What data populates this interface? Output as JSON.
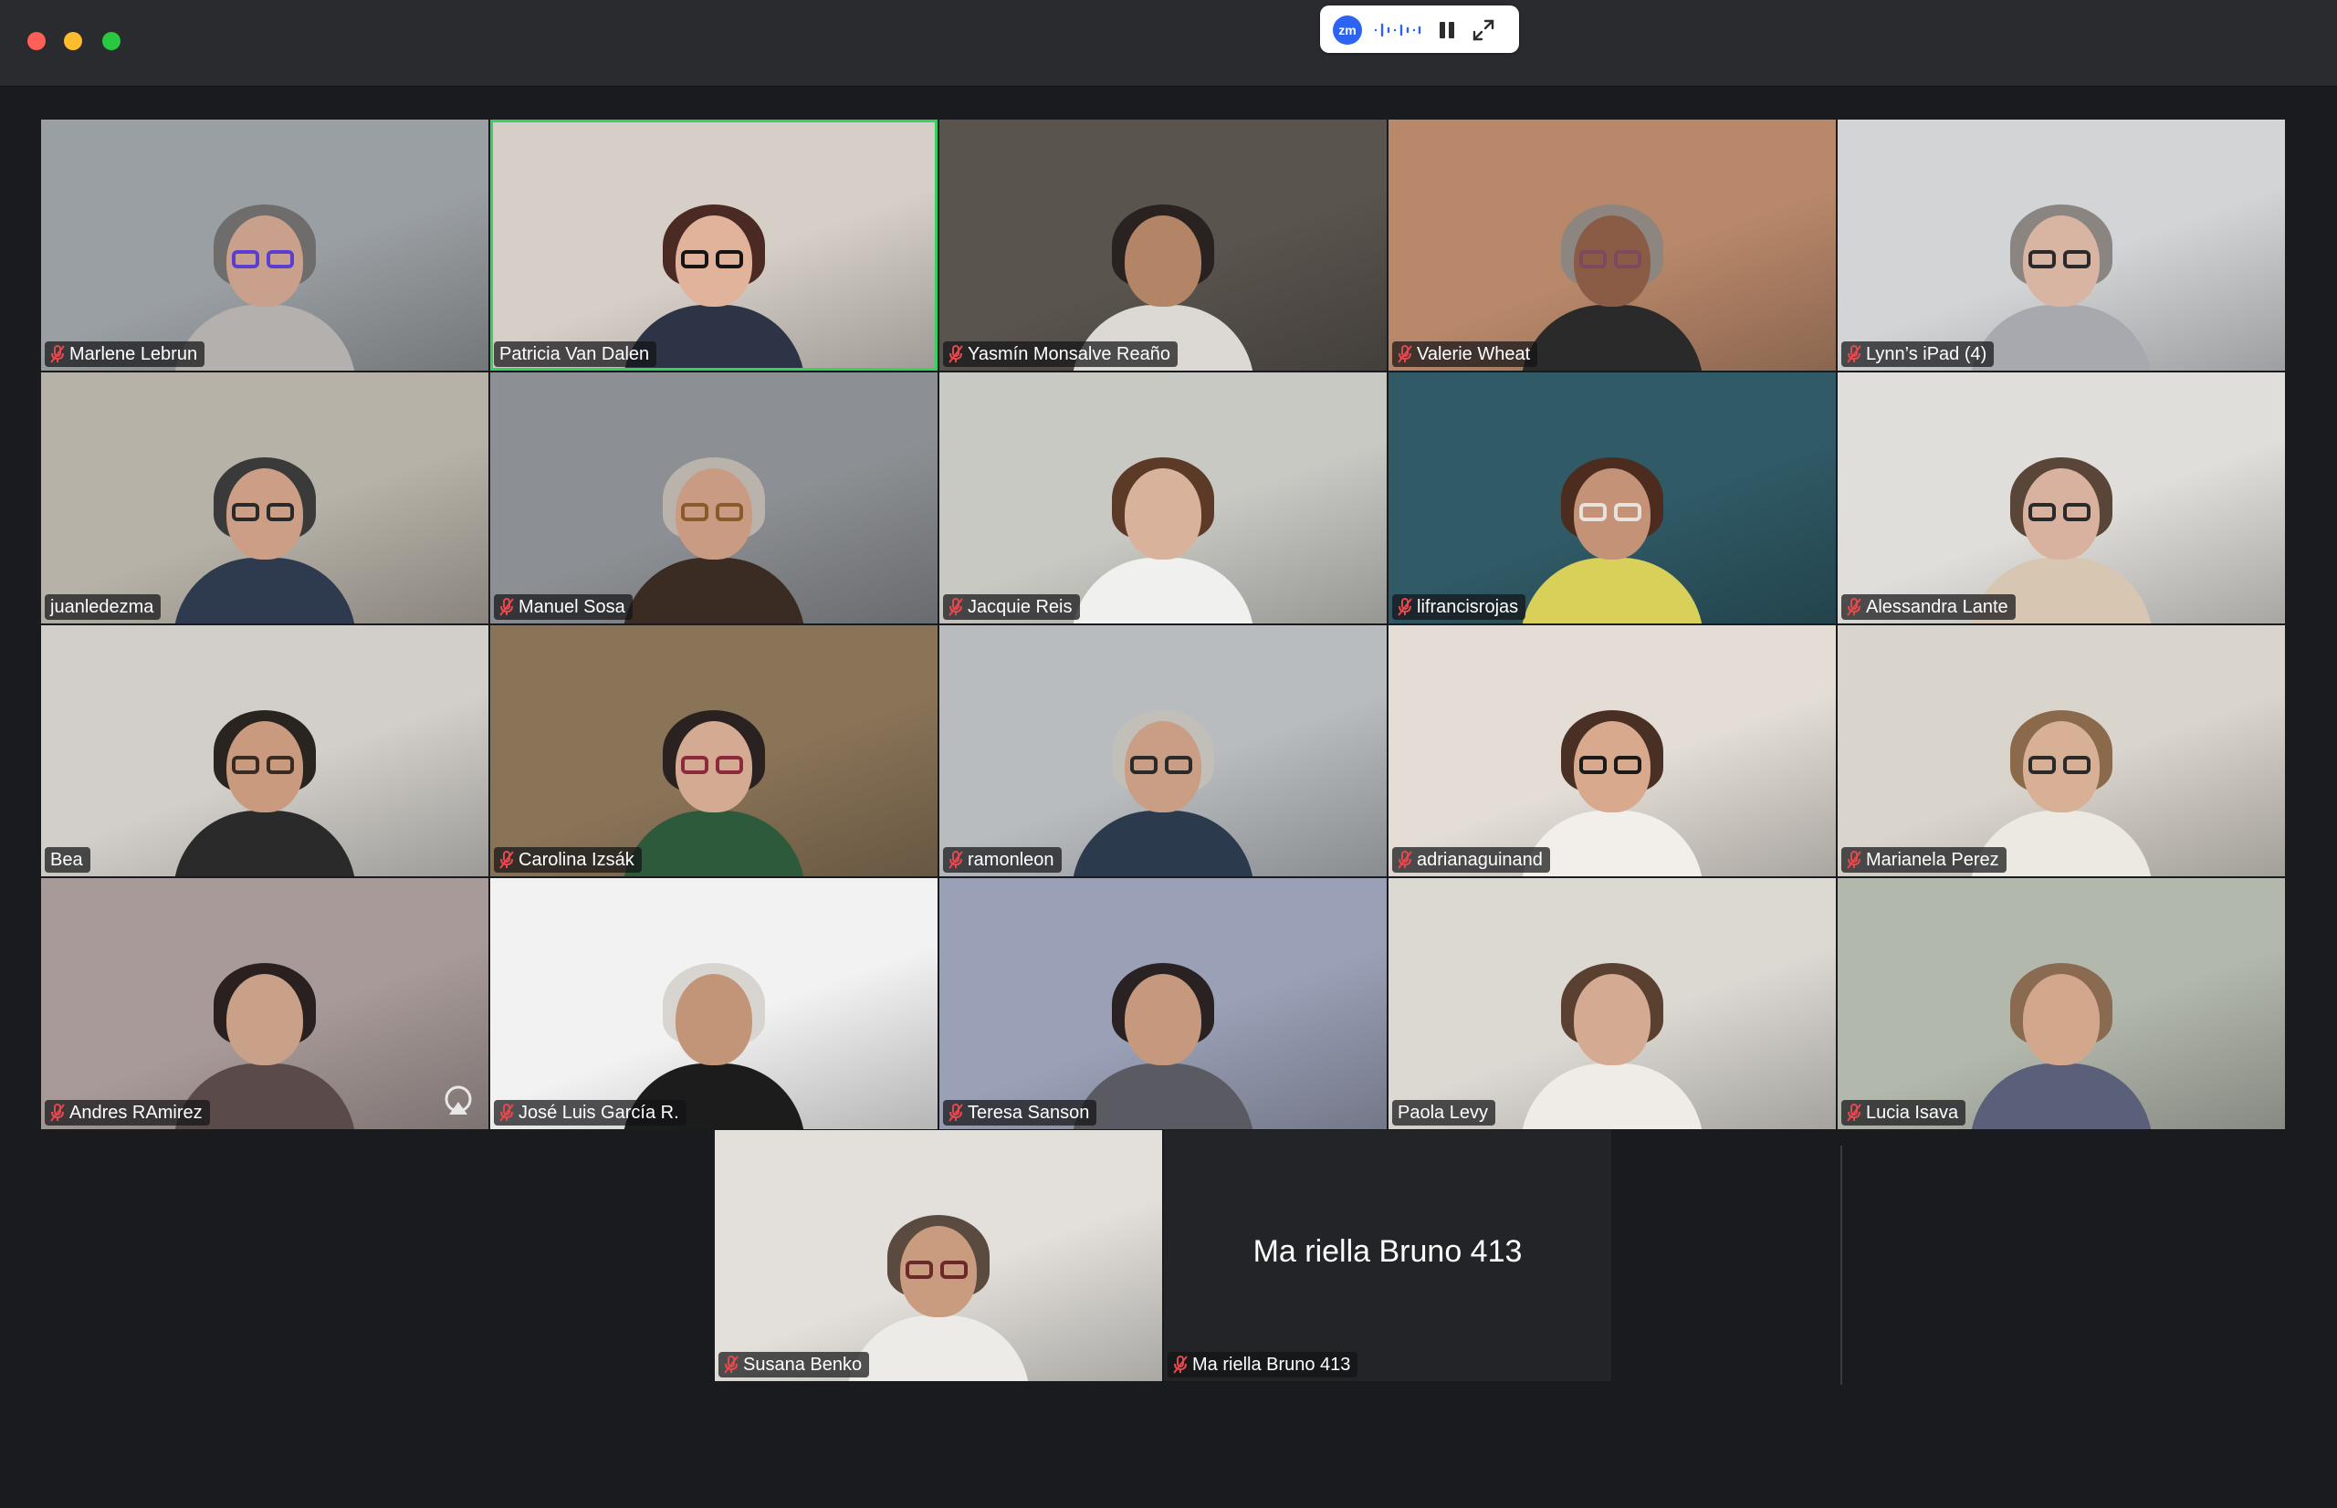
{
  "window": {
    "controls": [
      "close",
      "minimize",
      "zoom"
    ]
  },
  "recording_bar": {
    "logo_text": "zm",
    "icons": [
      "audio-wave-icon",
      "pause-icon",
      "expand-icon"
    ]
  },
  "participants": [
    {
      "name": "Marlene Lebrun",
      "muted": true,
      "active": false,
      "bg": "#9a9fa3",
      "skin": "#c8a08b",
      "hair": "#6f6d6b",
      "shirt": "#b3b0ad",
      "glasses": "#5a3fcf"
    },
    {
      "name": "Patricia Van Dalen",
      "muted": false,
      "active": true,
      "bg": "#d6cfc8",
      "skin": "#e0b39a",
      "hair": "#4a2a22",
      "shirt": "#2d3446",
      "glasses": "#151515"
    },
    {
      "name": "Yasmín Monsalve Reaño",
      "muted": true,
      "active": false,
      "bg": "#5a544e",
      "skin": "#b38465",
      "hair": "#2a2220",
      "shirt": "#dcd9d4",
      "glasses": ""
    },
    {
      "name": "Valerie Wheat",
      "muted": true,
      "active": false,
      "bg": "#b9886a",
      "skin": "#8b5c45",
      "hair": "#8d8680",
      "shirt": "#2a2a2a",
      "glasses": "#7b4a5e"
    },
    {
      "name": "Lynn’s iPad (4)",
      "muted": true,
      "active": false,
      "bg": "#d2d4d6",
      "skin": "#d8b4a2",
      "hair": "#8a8580",
      "shirt": "#a7a9ae",
      "glasses": "#2a2a2a"
    },
    {
      "name": "juanledezma",
      "muted": false,
      "active": false,
      "bg": "#b7b2a8",
      "skin": "#cc9e86",
      "hair": "#3a3a3a",
      "shirt": "#2e3a4e",
      "glasses": "#2a2a2a"
    },
    {
      "name": "Manuel Sosa",
      "muted": true,
      "active": false,
      "bg": "#8c8f93",
      "skin": "#c89b82",
      "hair": "#b9b3ab",
      "shirt": "#3a2c22",
      "glasses": "#8a5a2a"
    },
    {
      "name": "Jacquie Reis",
      "muted": true,
      "active": false,
      "bg": "#c9c9c4",
      "skin": "#d8b29a",
      "hair": "#5c3a28",
      "shirt": "#f0f0ee",
      "glasses": ""
    },
    {
      "name": "lifrancisrojas",
      "muted": true,
      "active": false,
      "bg": "#2f5a66",
      "skin": "#c49277",
      "hair": "#4b2c1e",
      "shirt": "#d9d05a",
      "glasses": "#e7e2dc"
    },
    {
      "name": "Alessandra Lante",
      "muted": true,
      "active": false,
      "bg": "#e0deda",
      "skin": "#d8b29f",
      "hair": "#5a4638",
      "shirt": "#d6c6b2",
      "glasses": "#2a2a2a"
    },
    {
      "name": "Bea",
      "muted": false,
      "active": false,
      "bg": "#d2cfca",
      "skin": "#c99a7d",
      "hair": "#2a2420",
      "shirt": "#2a2a2a",
      "glasses": "#3a2a24"
    },
    {
      "name": "Carolina Izsák",
      "muted": true,
      "active": false,
      "bg": "#8a7458",
      "skin": "#d4ab92",
      "hair": "#2a2220",
      "shirt": "#2d5a3a",
      "glasses": "#8a2a3a"
    },
    {
      "name": "ramonleon",
      "muted": true,
      "active": false,
      "bg": "#b8bcbf",
      "skin": "#c99e85",
      "hair": "#c2bfb8",
      "shirt": "#2c3a4e",
      "glasses": "#2a2a2a"
    },
    {
      "name": "adrianaguinand",
      "muted": true,
      "active": false,
      "bg": "#e3ddd6",
      "skin": "#d9a98e",
      "hair": "#4a3024",
      "shirt": "#f2efea",
      "glasses": "#1a1a1a"
    },
    {
      "name": "Marianela Perez",
      "muted": true,
      "active": false,
      "bg": "#d9d4cc",
      "skin": "#d8b096",
      "hair": "#8a6a4a",
      "shirt": "#ece8e2",
      "glasses": "#2a2a2a"
    },
    {
      "name": "Andres RAmirez",
      "muted": true,
      "active": false,
      "bg": "#a79a98",
      "skin": "#c9a088",
      "hair": "#2a2020",
      "shirt": "#5a4a4a",
      "glasses": ""
    },
    {
      "name": "José Luis García R.",
      "muted": true,
      "active": false,
      "bg": "#f2f2f2",
      "skin": "#c29478",
      "hair": "#d8d4cf",
      "shirt": "#1c1c1c",
      "glasses": ""
    },
    {
      "name": "Teresa Sanson",
      "muted": true,
      "active": false,
      "bg": "#9aa0b6",
      "skin": "#c6997e",
      "hair": "#2a2222",
      "shirt": "#5a5a62",
      "glasses": ""
    },
    {
      "name": "Paola Levy",
      "muted": false,
      "active": false,
      "bg": "#dcd9d3",
      "skin": "#d4ab92",
      "hair": "#5a4030",
      "shirt": "#efece7",
      "glasses": ""
    },
    {
      "name": "Lucia Isava",
      "muted": true,
      "active": false,
      "bg": "#b3b8ad",
      "skin": "#d3a78c",
      "hair": "#8a6a50",
      "shirt": "#5a5f7a",
      "glasses": ""
    },
    {
      "name": "Susana Benko",
      "muted": true,
      "active": false,
      "bg": "#e3e0db",
      "skin": "#c99b7f",
      "hair": "#5a4a40",
      "shirt": "#ecebe8",
      "glasses": "#6a2a2a"
    }
  ],
  "placeholder": {
    "display_name": "Ma riella Bruno 413",
    "label": "Ma riella Bruno 413",
    "muted": true
  }
}
